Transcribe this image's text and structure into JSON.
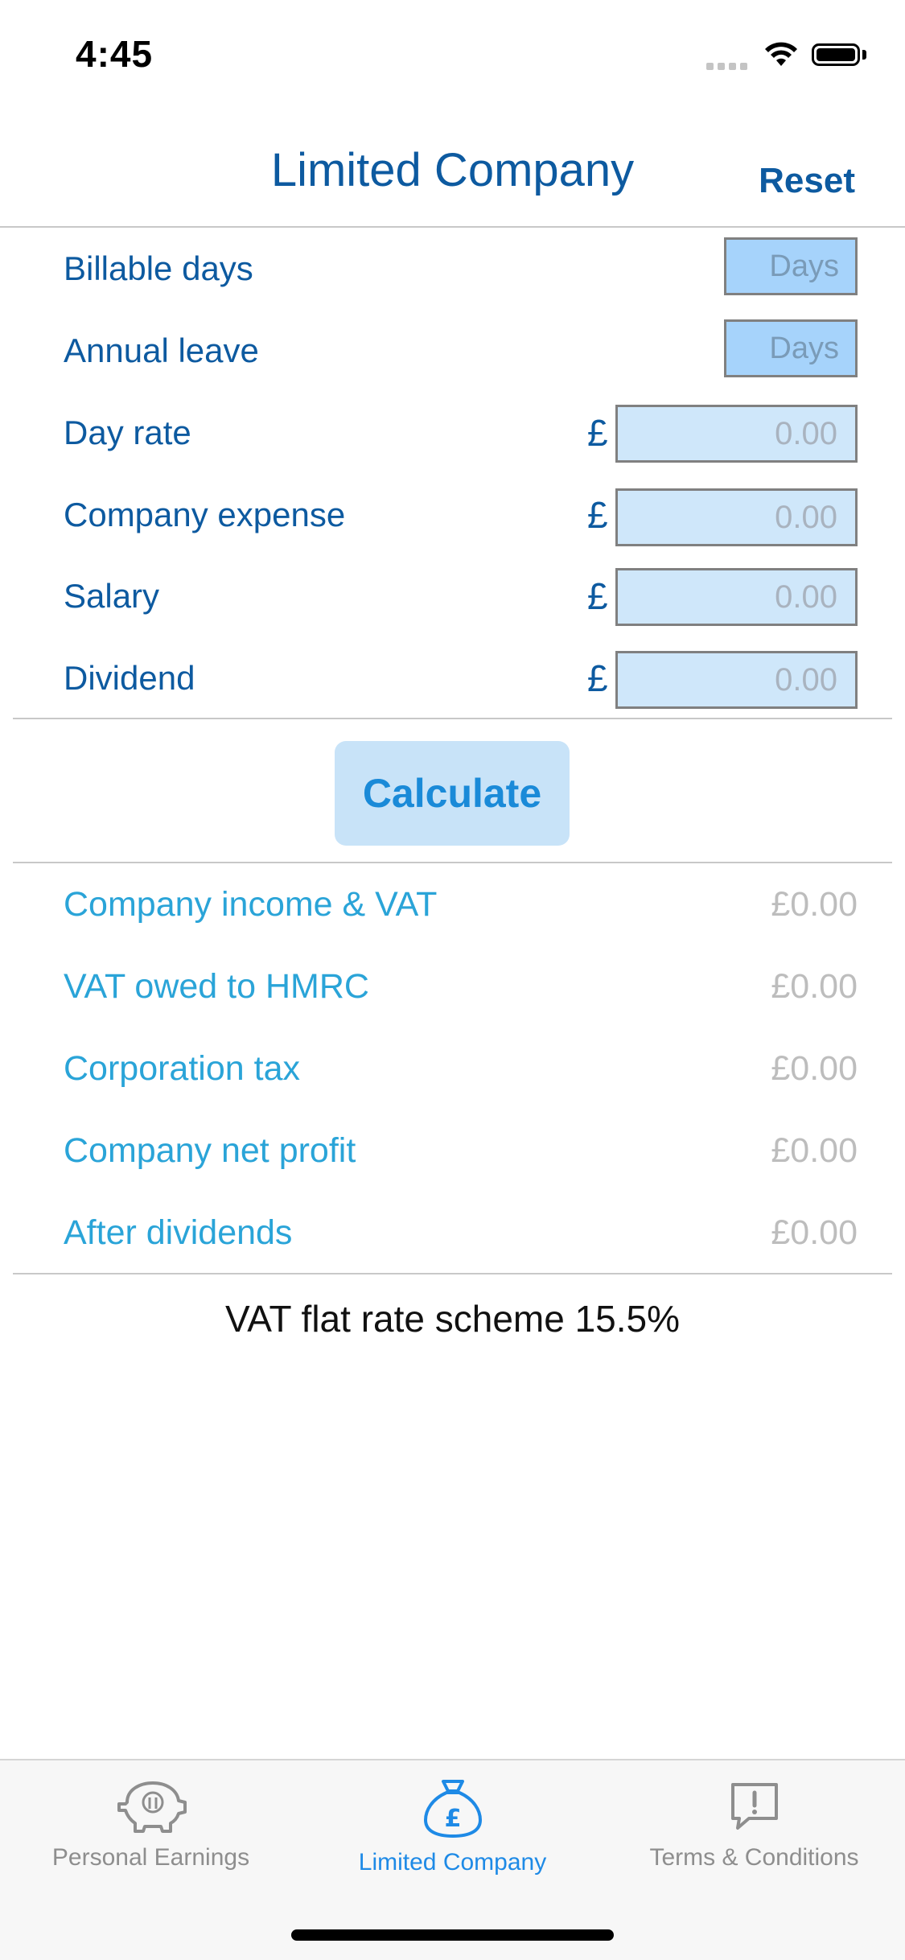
{
  "status_bar": {
    "time": "4:45"
  },
  "nav": {
    "title": "Limited Company",
    "reset_label": "Reset"
  },
  "inputs": {
    "billable_days": {
      "label": "Billable days",
      "placeholder": "Days"
    },
    "annual_leave": {
      "label": "Annual leave",
      "placeholder": "Days"
    },
    "day_rate": {
      "label": "Day rate",
      "currency": "£",
      "placeholder": "0.00"
    },
    "company_expense": {
      "label": "Company expense",
      "currency": "£",
      "placeholder": "0.00"
    },
    "salary": {
      "label": "Salary",
      "currency": "£",
      "placeholder": "0.00"
    },
    "dividend": {
      "label": "Dividend",
      "currency": "£",
      "placeholder": "0.00"
    }
  },
  "calculate_label": "Calculate",
  "results": [
    {
      "label": "Company income & VAT",
      "value": "£0.00"
    },
    {
      "label": "VAT owed to HMRC",
      "value": "£0.00"
    },
    {
      "label": "Corporation tax",
      "value": "£0.00"
    },
    {
      "label": "Company net profit",
      "value": "£0.00"
    },
    {
      "label": "After dividends",
      "value": "£0.00"
    }
  ],
  "footer_note": "VAT flat rate scheme 15.5%",
  "tabs": [
    {
      "label": "Personal Earnings",
      "icon": "piggy-bank-icon",
      "active": false
    },
    {
      "label": "Limited Company",
      "icon": "money-bag-icon",
      "active": true
    },
    {
      "label": "Terms & Conditions",
      "icon": "info-bubble-icon",
      "active": false
    }
  ],
  "colors": {
    "primary": "#0d5aa0",
    "result_label": "#2aa4d8",
    "active_tab": "#1e8ae6",
    "days_input_bg": "#a6d3fb",
    "money_input_bg": "#cfe7fa",
    "calculate_bg": "#c8e3f8"
  }
}
